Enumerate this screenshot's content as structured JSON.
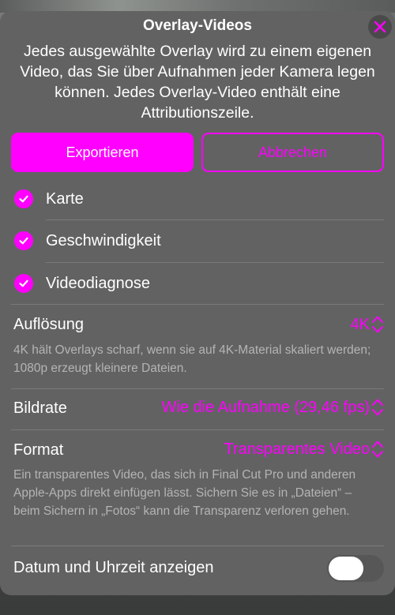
{
  "header": {
    "title": "Overlay-Videos",
    "close_icon": "close-icon"
  },
  "description": "Jedes ausgewählte Overlay wird zu einem eigenen Video, das Sie über Aufnahmen jeder Kamera legen können. Jedes Overlay-Video enthält eine Attributionszeile.",
  "buttons": {
    "export_label": "Exportieren",
    "cancel_label": "Abbrechen"
  },
  "overlays": [
    {
      "label": "Karte",
      "checked": true
    },
    {
      "label": "Geschwindigkeit",
      "checked": true
    },
    {
      "label": "Videodiagnose",
      "checked": true
    }
  ],
  "settings": {
    "resolution": {
      "label": "Auflösung",
      "value": "4K",
      "help": "4K hält Overlays scharf, wenn sie auf 4K-Material skaliert werden; 1080p erzeugt kleinere Dateien."
    },
    "framerate": {
      "label": "Bildrate",
      "value": "Wie die Aufnahme (29,46 fps)"
    },
    "format": {
      "label": "Format",
      "value": "Transparentes Video",
      "help": "Ein transparentes Video, das sich in Final Cut Pro und anderen Apple-Apps direkt einfügen lässt. Sichern Sie es in „Dateien“ – beim Sichern in „Fotos“ kann die Transparenz verloren gehen."
    },
    "datetime": {
      "label": "Datum und Uhrzeit anzeigen",
      "enabled": false
    }
  },
  "colors": {
    "accent": "#ff00ff",
    "sheet_background": "#626262",
    "help_text": "#b4b4b4"
  }
}
